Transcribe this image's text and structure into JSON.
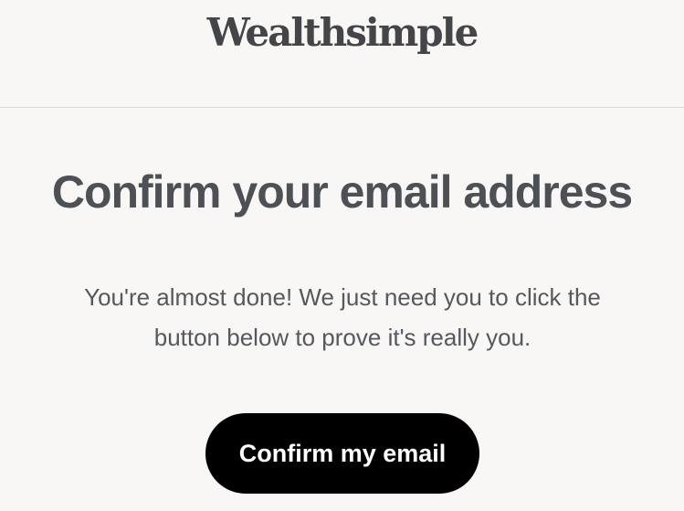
{
  "brand": {
    "logo_text": "Wealthsimple"
  },
  "main": {
    "title": "Confirm your email address",
    "message_line1": "You're almost done! We just need you to click the",
    "message_line2": "button below to prove it's really you.",
    "confirm_button_label": "Confirm my email"
  },
  "colors": {
    "background": "#f8f7f5",
    "text": "#4d5054",
    "button_background": "#000000",
    "button_text": "#ffffff",
    "divider": "#dcdad7"
  }
}
